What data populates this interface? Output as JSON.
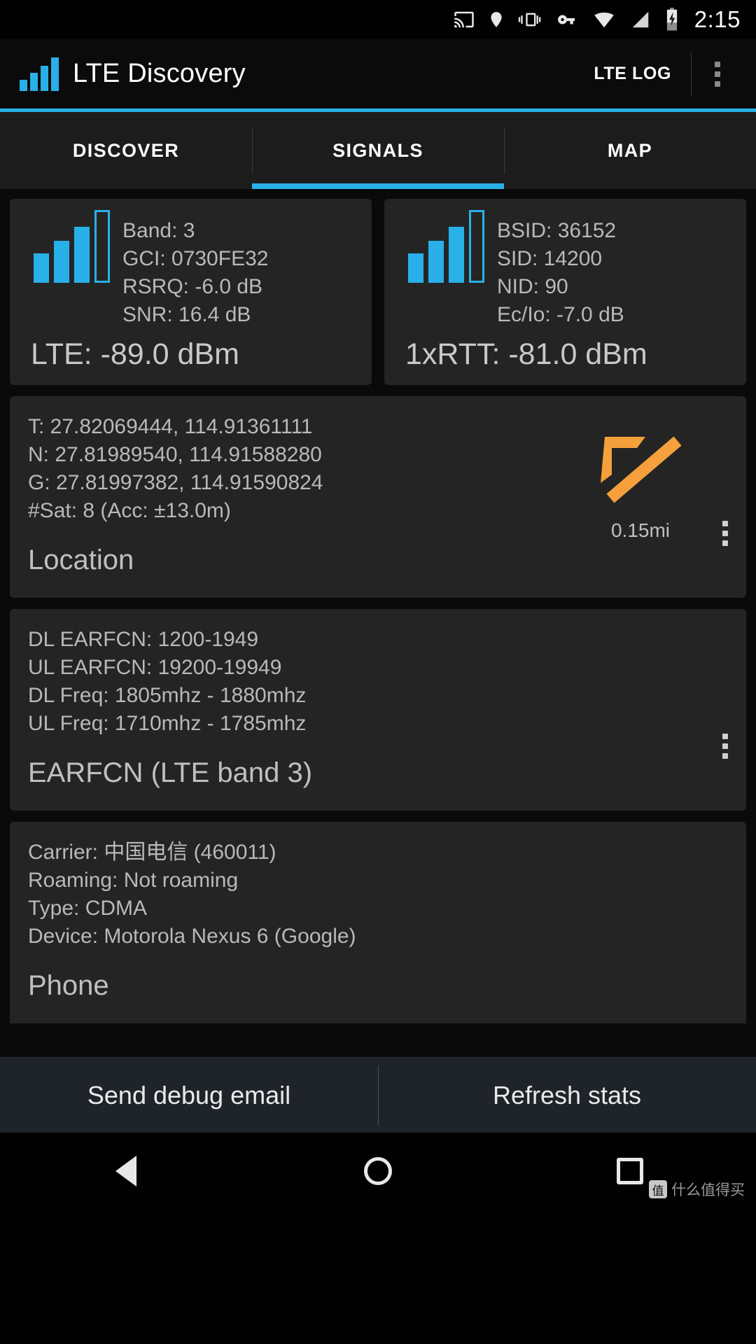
{
  "status_bar": {
    "icons": [
      "cast-icon",
      "location-pin-icon",
      "vibrate-icon",
      "vpn-key-icon",
      "wifi-icon",
      "cellular-signal-icon",
      "battery-charging-icon"
    ],
    "time": "2:15"
  },
  "action_bar": {
    "app_icon": "signal-bars-logo-icon",
    "title": "LTE Discovery",
    "lte_log_label": "LTE LOG",
    "overflow_icon": "overflow-menu-icon"
  },
  "tabs": [
    {
      "label": "DISCOVER",
      "active": false
    },
    {
      "label": "SIGNALS",
      "active": true
    },
    {
      "label": "MAP",
      "active": false
    }
  ],
  "signal_cards": [
    {
      "icon": "signal-bars-icon",
      "lines": [
        "Band: 3",
        "GCI: 0730FE32",
        "RSRQ: -6.0 dB",
        "SNR: 16.4 dB"
      ],
      "value": "LTE: -89.0 dBm"
    },
    {
      "icon": "signal-bars-icon",
      "lines": [
        "BSID: 36152",
        "SID: 14200",
        "NID: 90",
        "Ec/Io: -7.0 dB"
      ],
      "value": "1xRTT: -81.0 dBm"
    }
  ],
  "location_card": {
    "lines": [
      "T: 27.82069444, 114.91361111",
      "N: 27.81989540, 114.91588280",
      "G: 27.81997382, 114.91590824",
      "#Sat: 8 (Acc: ±13.0m)"
    ],
    "title": "Location",
    "arrow_icon": "direction-arrow-northwest-icon",
    "arrow_color": "#F5A03C",
    "distance": "0.15mi",
    "menu_icon": "overflow-menu-icon"
  },
  "earfcn_card": {
    "lines": [
      "DL EARFCN: 1200-1949",
      "UL EARFCN: 19200-19949",
      "DL Freq: 1805mhz - 1880mhz",
      "UL Freq: 1710mhz - 1785mhz"
    ],
    "title": "EARFCN (LTE band 3)",
    "menu_icon": "overflow-menu-icon"
  },
  "phone_card": {
    "lines": [
      "Carrier: 中国电信 (460011)",
      "Roaming: Not roaming",
      "Type: CDMA",
      "Device: Motorola Nexus 6 (Google)"
    ],
    "title": "Phone"
  },
  "bottom_actions": [
    {
      "label": "Send debug email"
    },
    {
      "label": "Refresh stats"
    }
  ],
  "nav_bar": {
    "back_icon": "back-triangle-icon",
    "home_icon": "home-circle-icon",
    "recents_icon": "recents-square-icon"
  },
  "watermark": {
    "badge": "值",
    "text": "什么值得买"
  },
  "colors": {
    "accent": "#29B0E8",
    "arrow": "#F5A03C",
    "card_bg": "#242424",
    "page_bg": "#0A0A0A"
  }
}
